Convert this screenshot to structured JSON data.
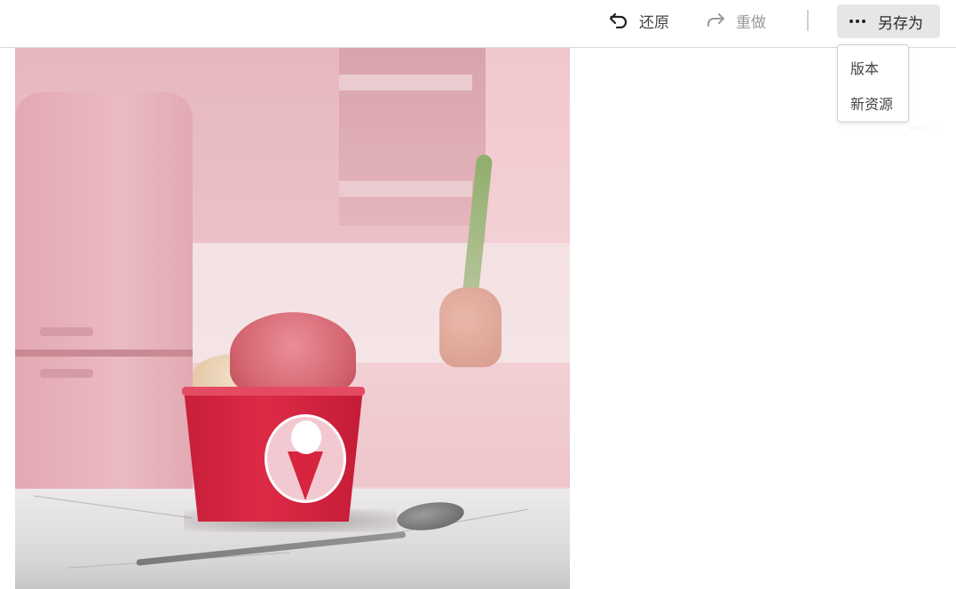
{
  "toolbar": {
    "undo_label": "还原",
    "redo_label": "重做",
    "save_as_label": "另存为",
    "undo_icon": "undo-arrow-icon",
    "redo_icon": "redo-arrow-icon",
    "more_icon": "more-dots-icon"
  },
  "save_menu": {
    "items": [
      {
        "label": "版本"
      },
      {
        "label": "新资源"
      }
    ]
  },
  "canvas": {
    "image_subject": "ice-cream-cup-photo"
  },
  "colors": {
    "toolbar_bg": "#ffffff",
    "save_button_bg": "#e6e6e6",
    "disabled_text": "#9a9a9a",
    "cup_red": "#d7243f"
  }
}
